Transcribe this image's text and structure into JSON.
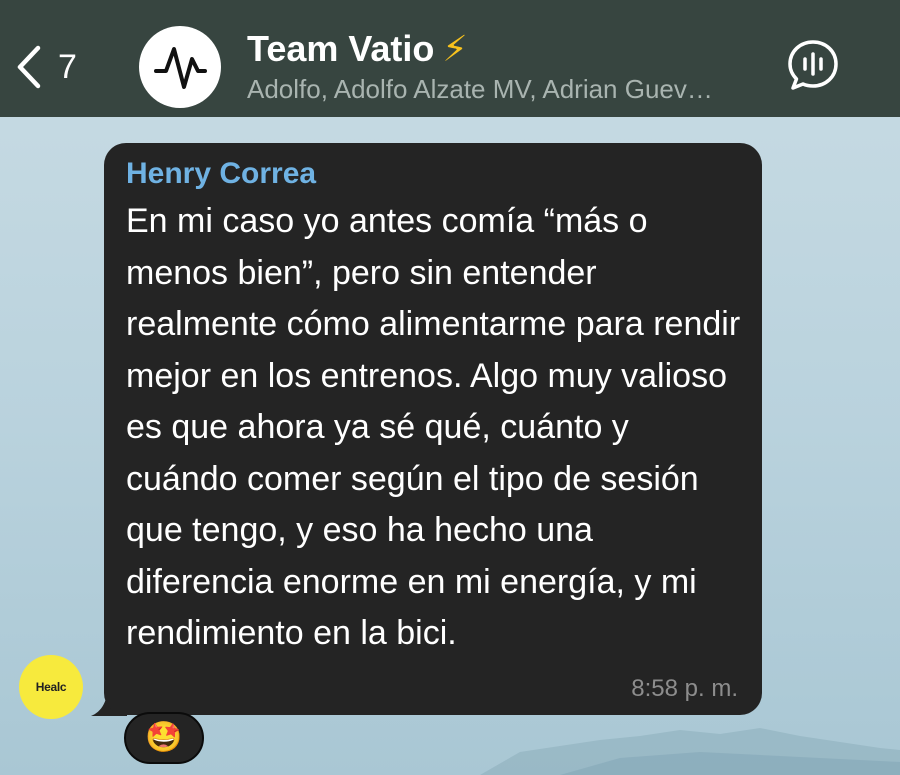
{
  "header": {
    "back_count": "7",
    "title": "Team Vatio",
    "title_emoji": "⚡",
    "subtitle": "Adolfo, Adolfo Alzate MV, Adrian Guev…",
    "avatar_icon": "vatio-logo-icon",
    "voice_chat_icon": "voice-chat-icon"
  },
  "message": {
    "sender": "Henry Correa",
    "text": "En mi caso yo antes comía “más o menos bien”, pero sin entender realmente cómo alimentarme para rendir mejor en los entrenos. Algo muy valioso es que ahora ya sé qué, cuánto y cuándo comer según el tipo de sesión que tengo, y eso ha hecho una diferencia enorme en mi energía, y mi rendimiento en la bici.",
    "time": "8:58 p. m.",
    "sender_avatar_text": "Healc",
    "reaction": "🤩"
  },
  "colors": {
    "header_bg": "#374540",
    "bubble_bg": "#242424",
    "sender_name": "#6fb2e3",
    "avatar_bg": "#f7ea3d",
    "bolt": "#f8c21d"
  }
}
